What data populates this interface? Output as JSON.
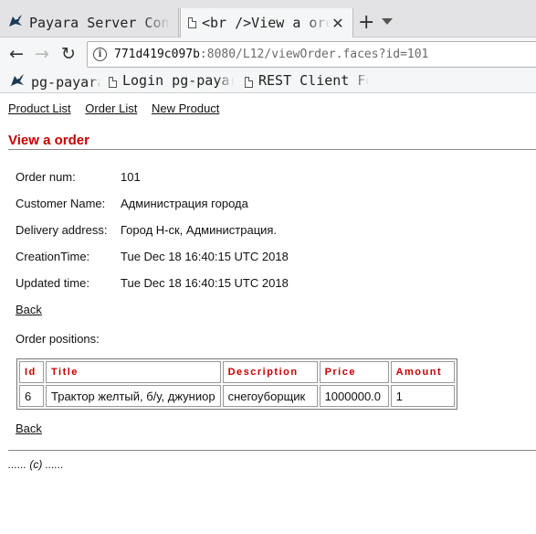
{
  "browser": {
    "tabs": [
      {
        "title": "Payara Server Console",
        "icon": "payara-fish-icon",
        "active": false
      },
      {
        "title": "<br />View a order",
        "icon": "page-icon",
        "active": true
      }
    ],
    "new_tab_symbol": "+",
    "url": {
      "host": "771d419c097b",
      "rest": ":8080/L12/viewOrder.faces?id=101"
    },
    "bookmarks": [
      {
        "label": "pg-payara",
        "icon": "payara-fish-icon"
      },
      {
        "label": "Login pg-payara",
        "icon": "page-icon"
      },
      {
        "label": "REST Client For",
        "icon": "page-icon"
      }
    ]
  },
  "page": {
    "menu": [
      "Product List",
      "Order List",
      "New Product"
    ],
    "heading": "View a order",
    "fields": [
      {
        "label": "Order num:",
        "value": "101"
      },
      {
        "label": "Customer Name:",
        "value": "Администрация города"
      },
      {
        "label": "Delivery address:",
        "value": "Город Н-ск, Администрация."
      },
      {
        "label": "CreationTime:",
        "value": "Tue Dec 18 16:40:15 UTC 2018"
      },
      {
        "label": "Updated time:",
        "value": "Tue Dec 18 16:40:15 UTC 2018"
      }
    ],
    "back_label": "Back",
    "positions_label": "Order positions:",
    "table": {
      "headers": [
        "Id",
        "Title",
        "Description",
        "Price",
        "Amount"
      ],
      "rows": [
        [
          "6",
          "Трактор желтый, б/у, джуниор",
          "снегоуборщик",
          "1000000.0",
          "1"
        ]
      ]
    },
    "back_label_2": "Back",
    "footer": "...... (c) ......",
    "colors": {
      "heading": "#c40000",
      "header_text": "#c40000"
    }
  }
}
